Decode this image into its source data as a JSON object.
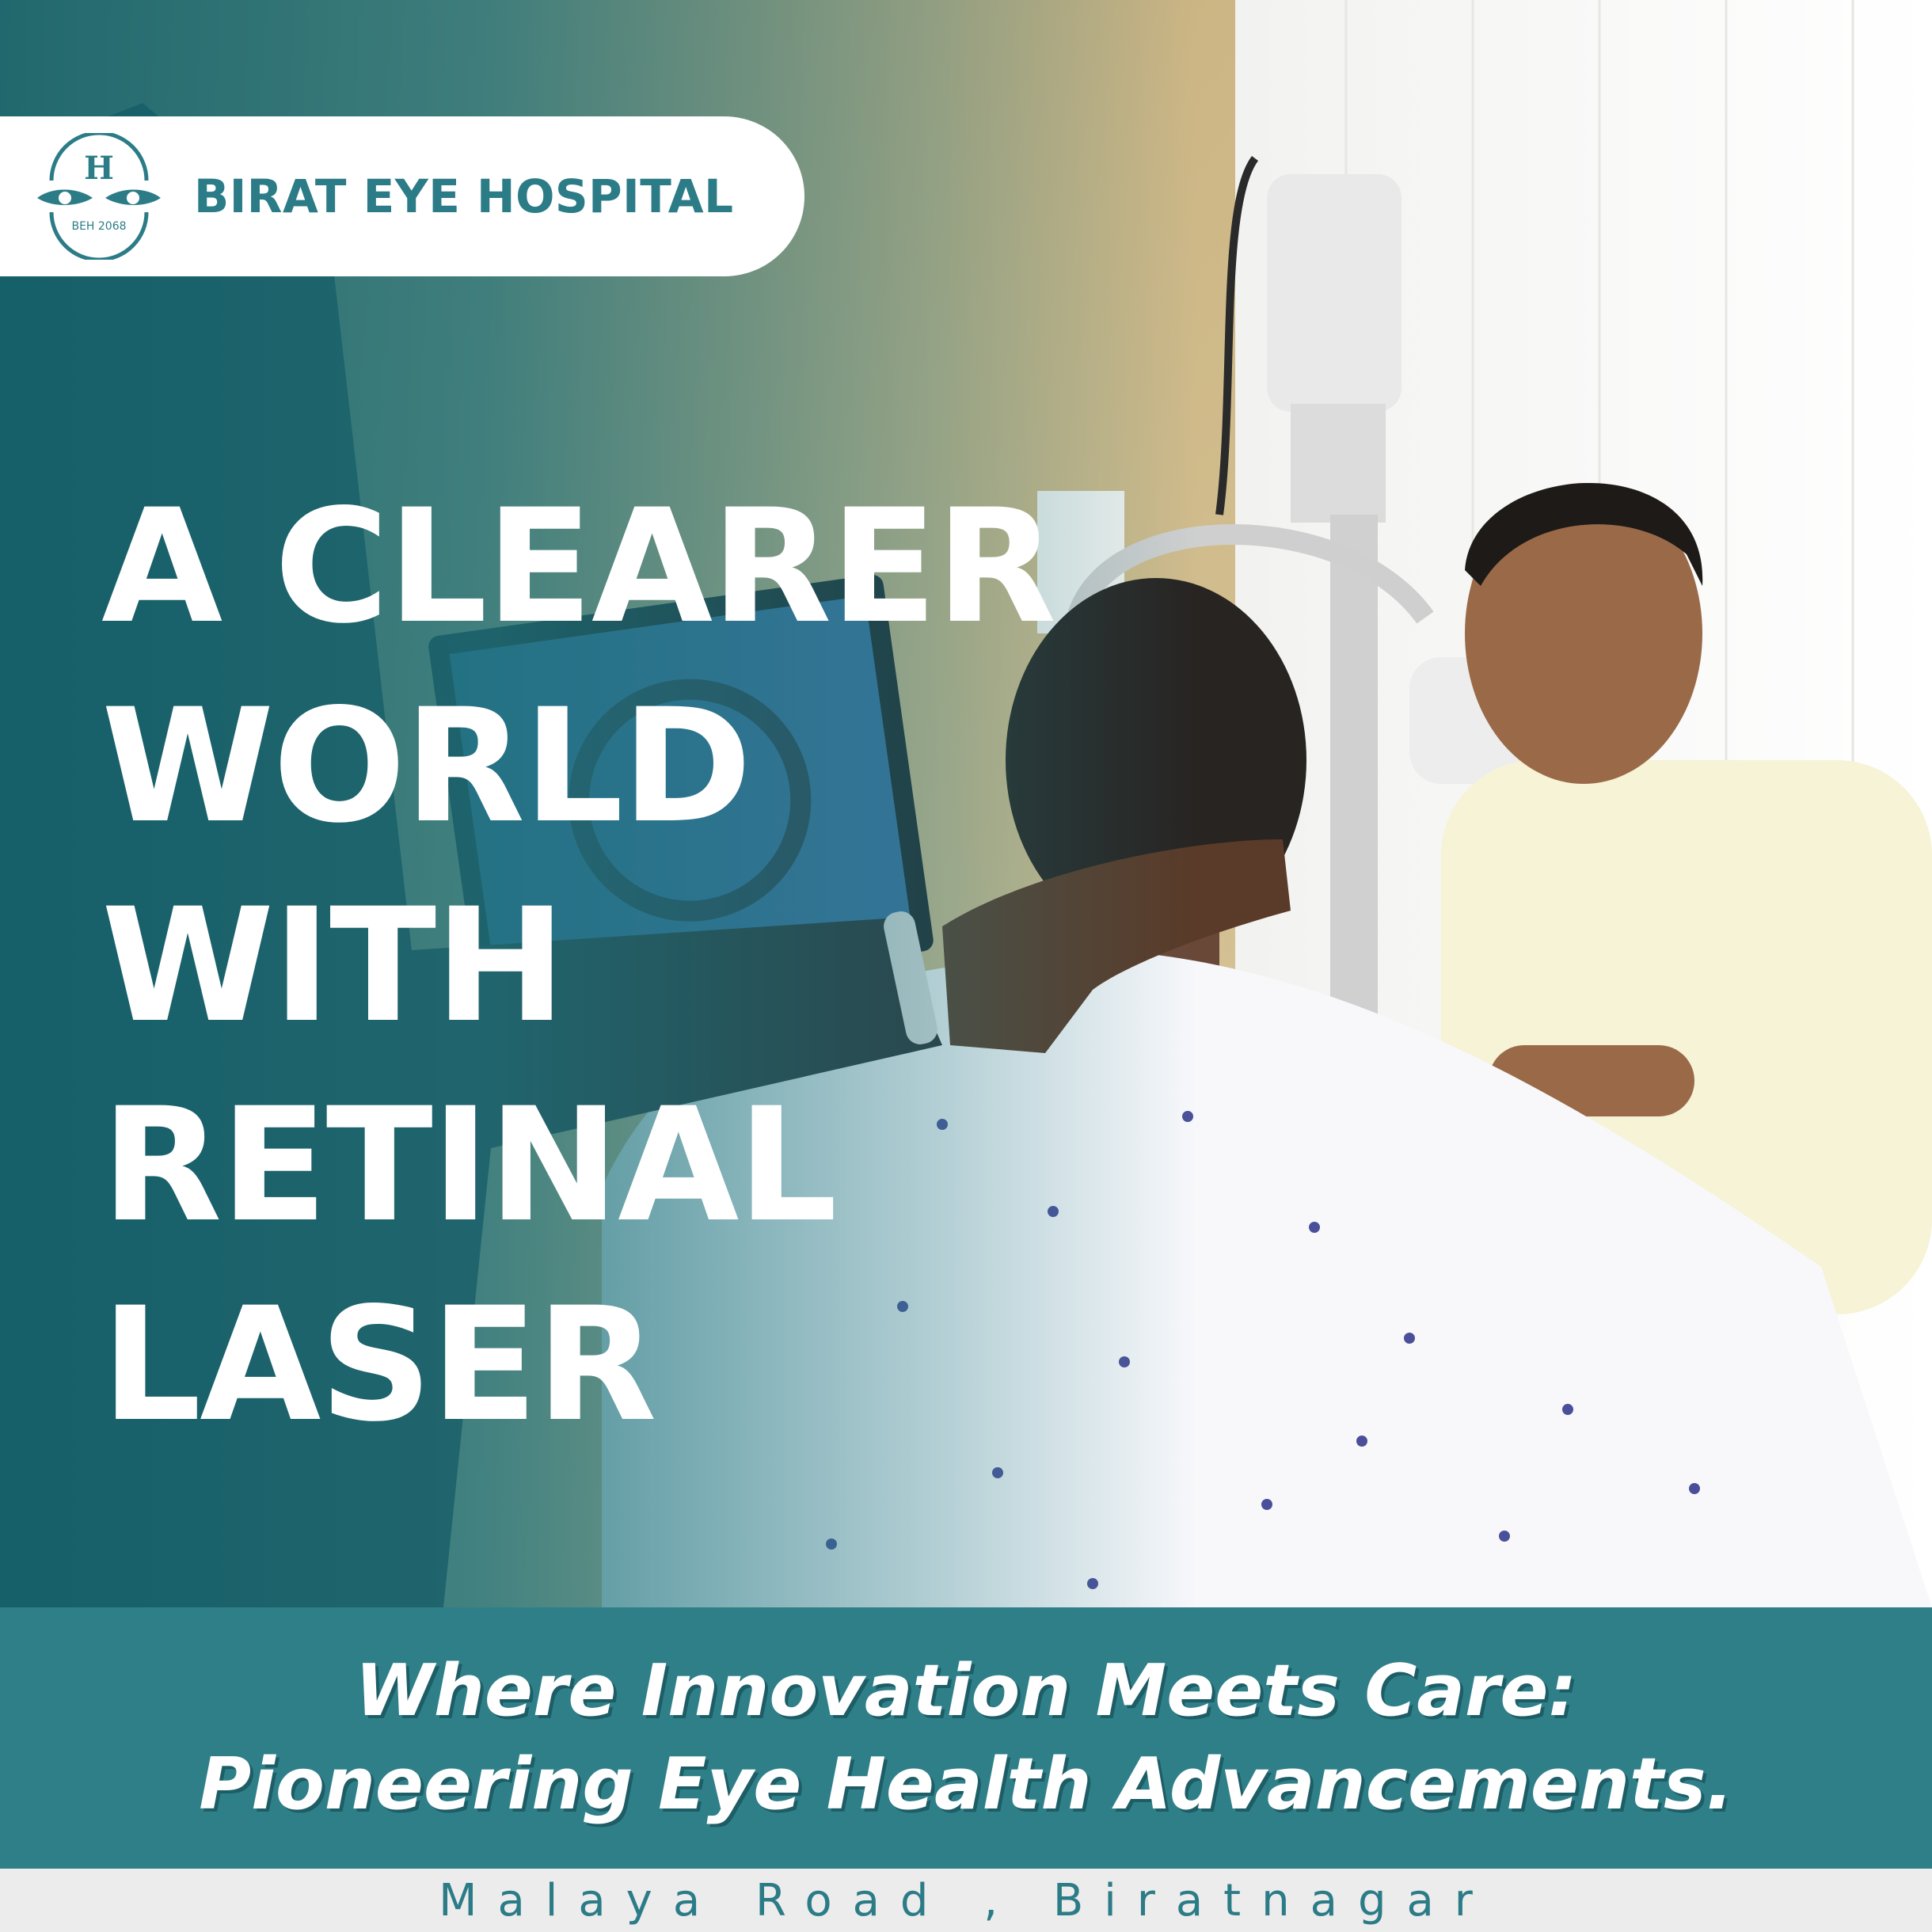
{
  "brand": {
    "name": "BIRAT EYE HOSPITAL",
    "logo_letter": "H",
    "logo_text": "BEH 2068",
    "logo_icon": "hospital-eyes-logo"
  },
  "headline": {
    "lines": [
      "A CLEARER",
      "WORLD",
      "WITH",
      "RETINAL",
      "LASER"
    ]
  },
  "photo": {
    "description_icon": "eye-examination-photo"
  },
  "tagline": {
    "line1": "Where Innovation Meets Care:",
    "line2": "Pioneering Eye Health Advancements."
  },
  "address": "Malaya Road , Biratnagar",
  "colors": {
    "teal": "#2f7f89",
    "teal_dark": "#1d5d66",
    "white": "#ffffff"
  }
}
